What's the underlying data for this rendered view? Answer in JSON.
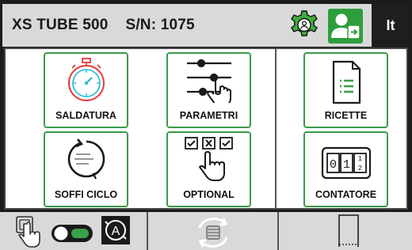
{
  "header": {
    "title": "XS TUBE 500    S/N: 1075",
    "language": "It"
  },
  "tiles": [
    {
      "label": "SALDATURA"
    },
    {
      "label": "PARAMETRI"
    },
    {
      "label": "RICETTE"
    },
    {
      "label": "SOFFI CICLO"
    },
    {
      "label": "OPTIONAL"
    },
    {
      "label": "CONTATORE"
    }
  ],
  "counter_display": "01",
  "colors": {
    "accent_green": "#3a9b48",
    "user_button": "#2e9e3c",
    "header_bg": "#d9d9d9",
    "stopwatch_red": "#e8393c",
    "stopwatch_cyan": "#1fb8d8"
  },
  "icons": {
    "gear": "gear-settings-icon",
    "user": "user-login-icon",
    "hand": "hand-touch-icon",
    "toggle": "toggle-switch",
    "auto": "auto-mode-icon",
    "cycle": "tube-rotate-icon",
    "tray": "tray-icon"
  }
}
